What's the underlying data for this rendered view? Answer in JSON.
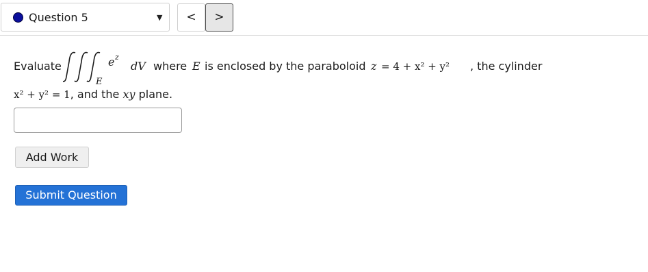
{
  "header": {
    "question_label": "Question 5",
    "status_color": "#0b0f9c",
    "dropdown_icon": "caret-down",
    "prev_icon": "chevron-left",
    "next_icon": "chevron-right",
    "prev_glyph": "<",
    "next_glyph": ">"
  },
  "problem": {
    "evaluate_word": "Evaluate",
    "integrand_base": "e",
    "integrand_exp": "z",
    "differential": "dV",
    "region_var": "E",
    "text_where": "where",
    "text_enclosed": "is enclosed by the paraboloid",
    "paraboloid_lhs": "z",
    "paraboloid_rhs": "= 4 + x² + y²",
    "text_cylinder": ", the cylinder",
    "cylinder_eq": "x² + y² = 1",
    "text_plane_pre": ", and the",
    "plane_var": "xy",
    "text_plane_post": "plane."
  },
  "answer": {
    "value": "",
    "placeholder": ""
  },
  "buttons": {
    "add_work": "Add Work",
    "submit": "Submit Question"
  }
}
